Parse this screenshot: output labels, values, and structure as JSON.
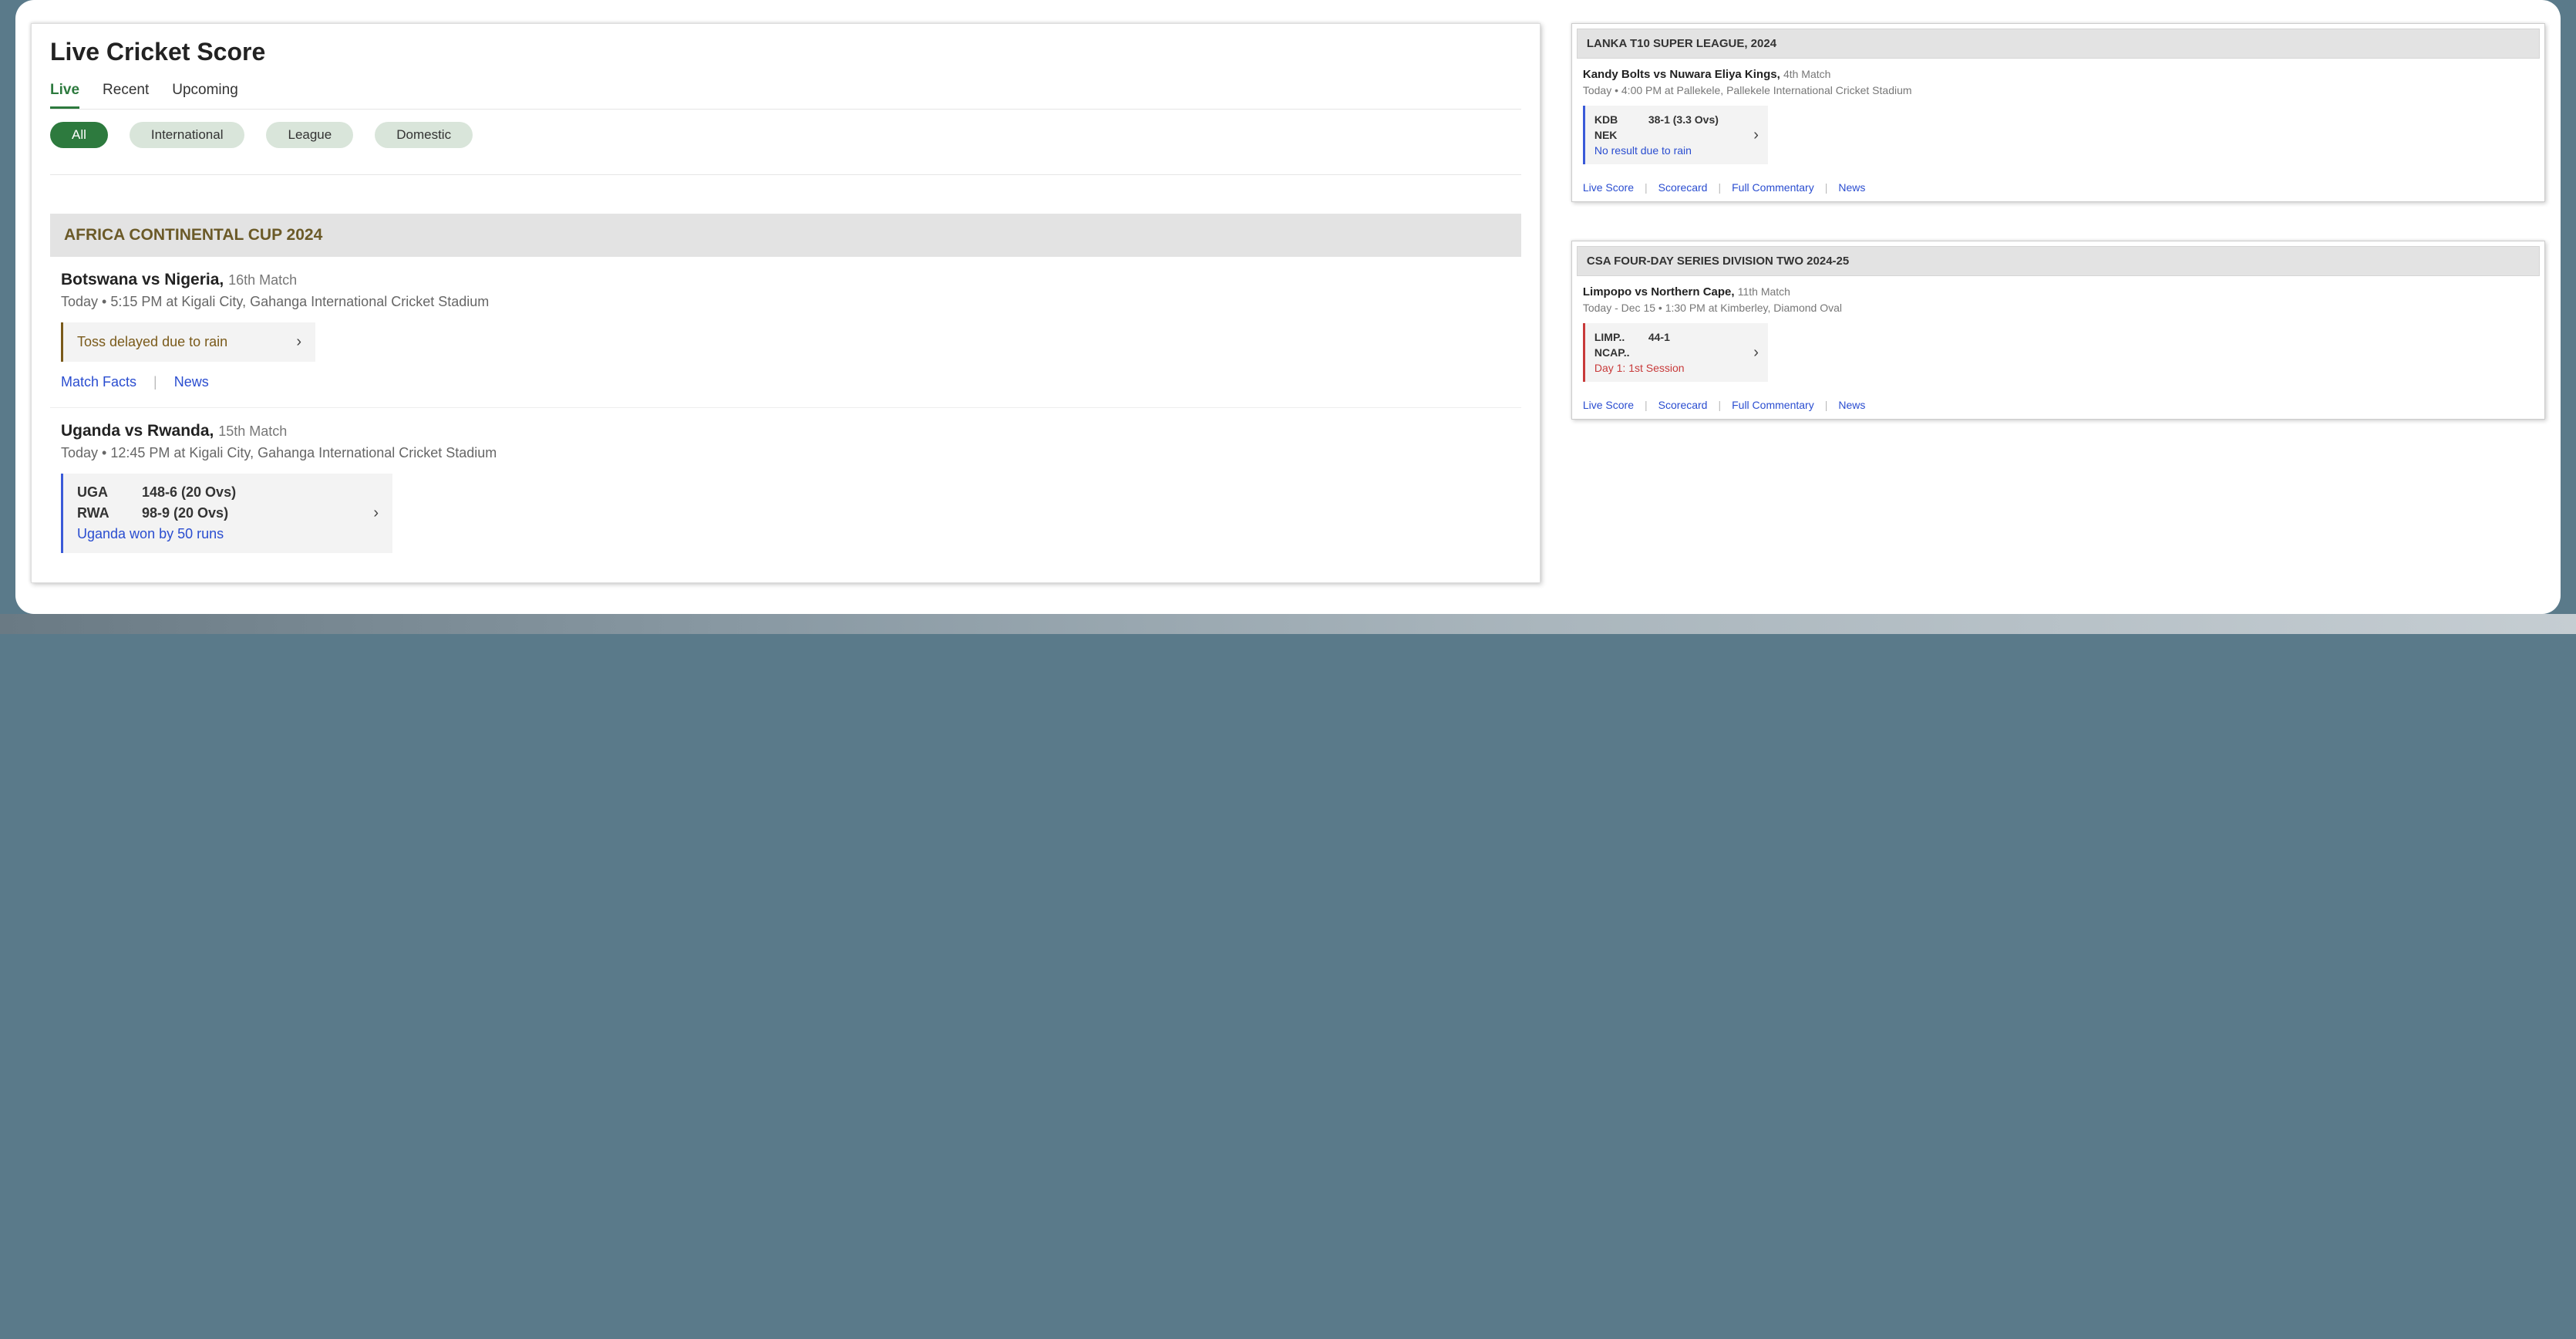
{
  "page_title": "Live Cricket Score",
  "top_tabs": [
    "Live",
    "Recent",
    "Upcoming"
  ],
  "active_top_tab": 0,
  "pills": [
    "All",
    "International",
    "League",
    "Domestic"
  ],
  "active_pill": 0,
  "main_series": {
    "title": "AFRICA CONTINENTAL CUP 2024",
    "matches": [
      {
        "teams": "Botswana vs Nigeria,",
        "meta": "16th Match",
        "sub": "Today  •  5:15 PM at Kigali City, Gahanga International Cricket Stadium",
        "box_style": "amber",
        "status_text": "Toss delayed due to rain",
        "lines": [],
        "result": "",
        "links": [
          "Match Facts",
          "News"
        ]
      },
      {
        "teams": "Uganda vs Rwanda,",
        "meta": "15th Match",
        "sub": "Today  •  12:45 PM at Kigali City, Gahanga International Cricket Stadium",
        "box_style": "blue",
        "status_text": "",
        "lines": [
          {
            "abbr": "UGA",
            "val": "148-6 (20 Ovs)"
          },
          {
            "abbr": "RWA",
            "val": "98-9 (20 Ovs)"
          }
        ],
        "result": "Uganda won by 50 runs",
        "links": []
      }
    ]
  },
  "side_cards": [
    {
      "header": "LANKA T10 SUPER LEAGUE, 2024",
      "teams": "Kandy Bolts vs Nuwara Eliya Kings,",
      "meta": "4th Match",
      "sub": "Today  •  4:00 PM at Pallekele, Pallekele International Cricket Stadium",
      "bar": "blue",
      "lines": [
        {
          "abbr": "KDB",
          "val": "38-1 (3.3 Ovs)"
        },
        {
          "abbr": "NEK",
          "val": ""
        }
      ],
      "result": "No result due to rain",
      "result_color": "blue",
      "links": [
        "Live Score",
        "Scorecard",
        "Full Commentary",
        "News"
      ]
    },
    {
      "header": "CSA FOUR-DAY SERIES DIVISION TWO 2024-25",
      "teams": "Limpopo vs Northern Cape,",
      "meta": "11th Match",
      "sub": "Today - Dec 15  •  1:30 PM at Kimberley, Diamond Oval",
      "bar": "red",
      "lines": [
        {
          "abbr": "LIMP..",
          "val": "44-1"
        },
        {
          "abbr": "NCAP..",
          "val": ""
        }
      ],
      "result": "Day 1: 1st Session",
      "result_color": "red",
      "links": [
        "Live Score",
        "Scorecard",
        "Full Commentary",
        "News"
      ]
    }
  ]
}
